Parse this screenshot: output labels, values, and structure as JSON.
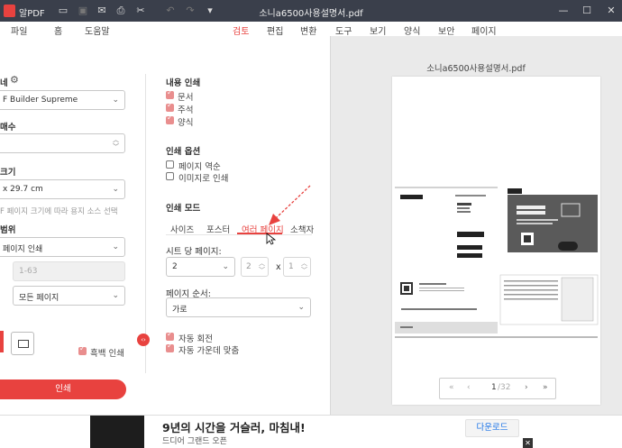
{
  "window": {
    "app_name": "알PDF",
    "doc_title": "소니a6500사용설명서.pdf",
    "toolbar_icons": [
      "folder-icon",
      "save-icon",
      "mail-icon",
      "print-icon",
      "scissors-icon",
      "undo-icon",
      "redo-icon",
      "dropdown-icon"
    ],
    "controls": [
      "minimize-icon",
      "maximize-icon",
      "close-icon"
    ]
  },
  "menu": {
    "items": [
      "파일",
      "홈",
      "도움말",
      "검토",
      "편집",
      "변환",
      "도구",
      "보기",
      "양식",
      "보안",
      "페이지"
    ],
    "active": "검토"
  },
  "printer": {
    "name": "F Builder Supreme",
    "copies_label": "매수",
    "size_label": "크기",
    "size_value": "x 29.7 cm",
    "size_hint": "F 페이지 크기에 따라 용지 소스 선택",
    "range_label": "범위",
    "range_value": "페이지 인쇄",
    "pages_value": "1-63",
    "subset_value": "모든 페이지",
    "grayscale_label": "흑백 인쇄",
    "print_button": "인쇄"
  },
  "content_print": {
    "title": "내용 인쇄",
    "items": [
      {
        "label": "문서",
        "checked": true
      },
      {
        "label": "주석",
        "checked": true
      },
      {
        "label": "양식",
        "checked": true
      }
    ]
  },
  "print_options": {
    "title": "인쇄 옵션",
    "items": [
      {
        "label": "페이지 역순",
        "checked": false
      },
      {
        "label": "이미지로 인쇄",
        "checked": false
      }
    ]
  },
  "print_mode": {
    "title": "인쇄 모드",
    "tabs": [
      "사이즈",
      "포스터",
      "여러 페이지",
      "소책자"
    ],
    "active_tab": "여러 페이지",
    "sheet_label": "시트 당 페이지:",
    "sheet_value": "2",
    "cols": "2",
    "times": "x",
    "rows": "1",
    "order_label": "페이지 순서:",
    "order_value": "가로",
    "auto_rotate": "자동 회전",
    "auto_center": "자동 가운데 맞춤"
  },
  "preview": {
    "title": "소니a6500사용설명서.pdf",
    "current_page": "1",
    "total_pages": "/32"
  },
  "ad": {
    "title": "9년의 시간을 거슬러, 마침내!",
    "subtitle": "드디어 그랜드 오픈",
    "button": "다운로드"
  },
  "colors": {
    "accent": "#e8423f",
    "titlebar": "#3a3f4b"
  }
}
